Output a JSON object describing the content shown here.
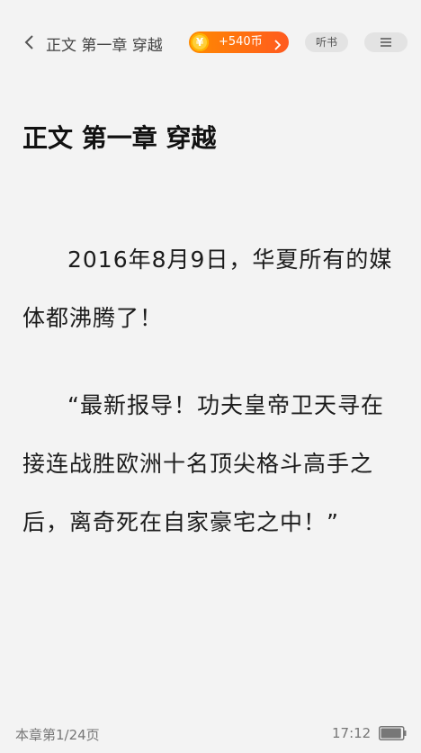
{
  "header": {
    "title": "正文 第一章 穿越",
    "coin_symbol": "¥",
    "coin_reward": "+540币",
    "listen_label": "听书"
  },
  "chapter": {
    "title": "正文 第一章 穿越",
    "paragraphs": [
      "2016年8月9日，华夏所有的媒体都沸腾了！",
      "“最新报导！功夫皇帝卫天寻在接连战胜欧洲十名顶尖格斗高手之后，离奇死在自家豪宅之中！”"
    ]
  },
  "footer": {
    "page_indicator": "本章第1/24页",
    "time": "17:12",
    "battery_level": 0.95
  },
  "colors": {
    "background": "#f3f3f3",
    "accent_gradient_start": "#ff8a00",
    "accent_gradient_end": "#ff5a1f",
    "coin": "#ffcf3a"
  },
  "icons": {
    "back": "chevron-left-icon",
    "coin": "coin-icon",
    "coin_arrow": "chevron-right-icon",
    "menu": "menu-icon",
    "battery": "battery-icon"
  }
}
